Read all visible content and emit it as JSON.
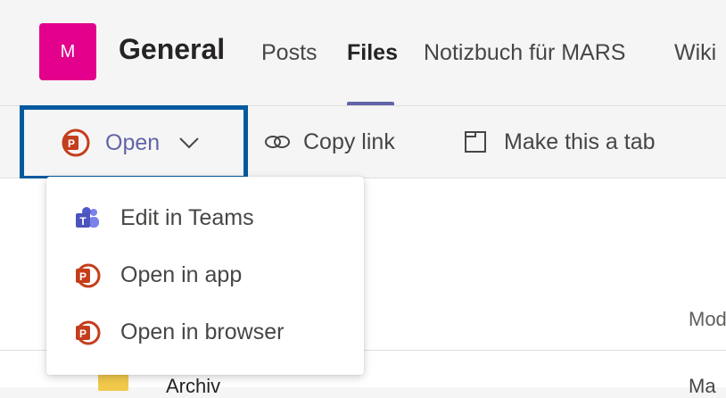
{
  "channel": {
    "avatar_initial": "M",
    "title": "General"
  },
  "tabs": [
    {
      "label": "Posts",
      "active": false
    },
    {
      "label": "Files",
      "active": true
    },
    {
      "label": "Notizbuch für MARS",
      "active": false
    },
    {
      "label": "Wiki",
      "active": false
    }
  ],
  "toolbar": {
    "open_label": "Open",
    "copy_link_label": "Copy link",
    "make_tab_label": "Make this a tab"
  },
  "open_menu": {
    "items": [
      {
        "label": "Edit in Teams",
        "icon": "teams-icon"
      },
      {
        "label": "Open in app",
        "icon": "powerpoint-icon"
      },
      {
        "label": "Open in browser",
        "icon": "powerpoint-icon"
      }
    ]
  },
  "file_list": {
    "modified_header": "Mod",
    "rows": [
      {
        "name": "Archiv",
        "modified": "Ma"
      }
    ]
  },
  "colors": {
    "accent": "#6264a7",
    "focus": "#005a9e",
    "avatar": "#e3008c",
    "powerpoint": "#c43e1c"
  }
}
